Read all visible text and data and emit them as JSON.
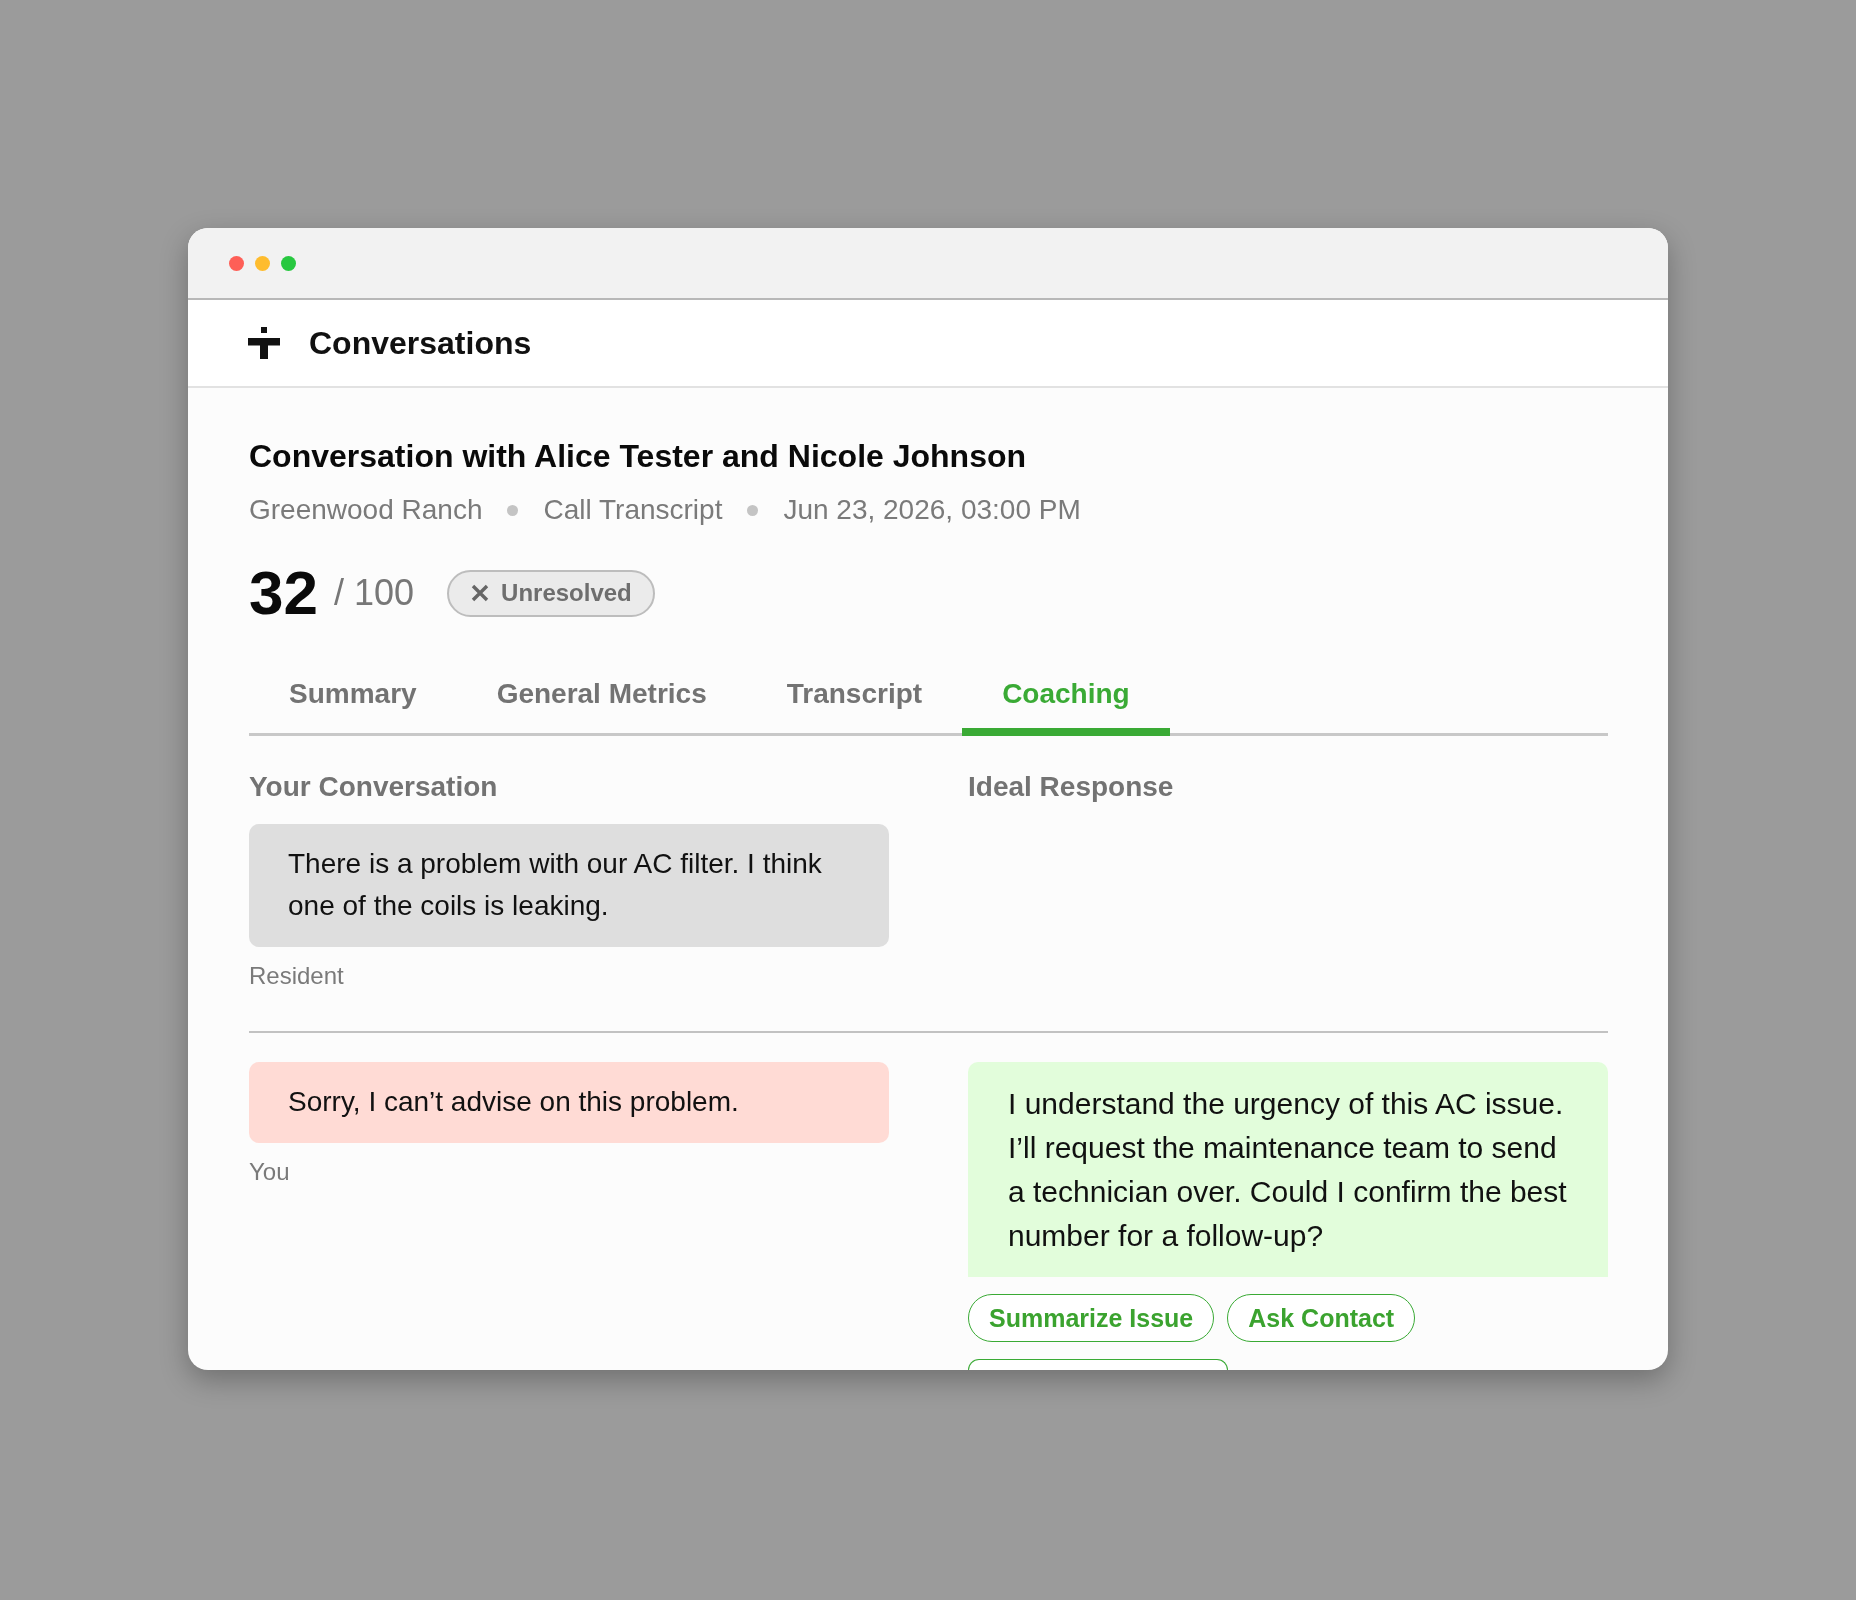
{
  "window": {
    "controls": [
      {
        "kind": "close"
      },
      {
        "kind": "minimize"
      },
      {
        "kind": "zoom"
      }
    ]
  },
  "header": {
    "title": "Conversations"
  },
  "conversation": {
    "title": "Conversation with Alice Tester and Nicole Johnson",
    "meta": [
      "Greenwood Ranch",
      "Call Transcript",
      "Jun 23, 2026, 03:00 PM"
    ],
    "score": "32",
    "score_max": "/ 100",
    "status": {
      "kind": "unresolved",
      "label": "Unresolved"
    }
  },
  "tabs": [
    {
      "label": "Summary",
      "selected": false
    },
    {
      "label": "General Metrics",
      "selected": false
    },
    {
      "label": "Transcript",
      "selected": false
    },
    {
      "label": "Coaching",
      "selected": true
    }
  ],
  "coaching": {
    "columns": [
      "Your Conversation",
      "Ideal Response"
    ],
    "exchanges": [
      {
        "yours": {
          "kind": "resident",
          "text": "There is a problem with our AC filter. I think one of the coils is leaking.",
          "speaker": "Resident"
        }
      },
      {
        "yours": {
          "kind": "agent",
          "text": "Sorry, I can’t advise on this problem.",
          "speaker": "You"
        },
        "ideal": {
          "text": "I understand the urgency of this AC issue. I’ll request the maintenance team to send a technician over. Could I confirm the best number for a follow-up?",
          "suggestions": [
            {
              "kind": "chip",
              "label": "Summarize Issue"
            },
            {
              "kind": "chip",
              "label": "Ask Contact"
            },
            {
              "kind": "clipped"
            }
          ]
        }
      }
    ]
  }
}
